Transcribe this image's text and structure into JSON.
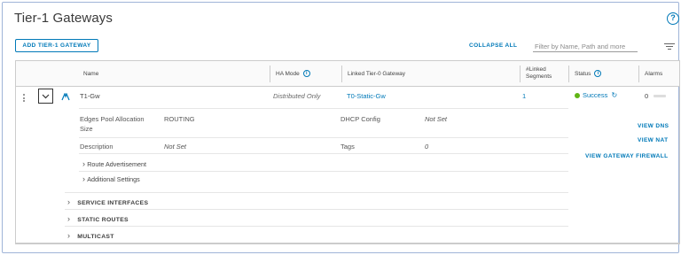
{
  "page": {
    "title": "Tier-1 Gateways"
  },
  "toolbar": {
    "add_label": "ADD TIER-1 GATEWAY",
    "collapse_label": "COLLAPSE ALL",
    "filter_placeholder": "Filter by Name, Path and more"
  },
  "columns": {
    "name": "Name",
    "ha_mode": "HA Mode",
    "linked_tier0": "Linked Tier-0 Gateway",
    "linked_segments_1": "#Linked",
    "linked_segments_2": "Segments",
    "status": "Status",
    "alarms": "Alarms"
  },
  "row": {
    "name": "T1-Gw",
    "ha_mode": "Distributed Only",
    "linked_tier0": "T0-Static-Gw",
    "linked_segments": "1",
    "status": "Success",
    "alarms": "0"
  },
  "details": {
    "edges_pool_label_1": "Edges Pool Allocation",
    "edges_pool_label_2": "Size",
    "edges_pool_value": "ROUTING",
    "dhcp_label": "DHCP Config",
    "dhcp_value": "Not Set",
    "description_label": "Description",
    "description_value": "Not Set",
    "tags_label": "Tags",
    "tags_value": "0",
    "route_advertisement": "Route Advertisement",
    "additional_settings": "Additional Settings"
  },
  "actions": {
    "view_dns": "VIEW DNS",
    "view_nat": "VIEW NAT",
    "view_firewall": "VIEW GATEWAY FIREWALL"
  },
  "sections": {
    "service_interfaces": "SERVICE INTERFACES",
    "static_routes": "STATIC ROUTES",
    "multicast": "MULTICAST"
  },
  "colors": {
    "accent": "#0079b8",
    "success": "#60b515"
  },
  "icons": [
    "help-icon",
    "info-icon",
    "filter-icon",
    "chevron-down-icon",
    "chevron-right-icon",
    "gateway-icon",
    "refresh-icon"
  ]
}
